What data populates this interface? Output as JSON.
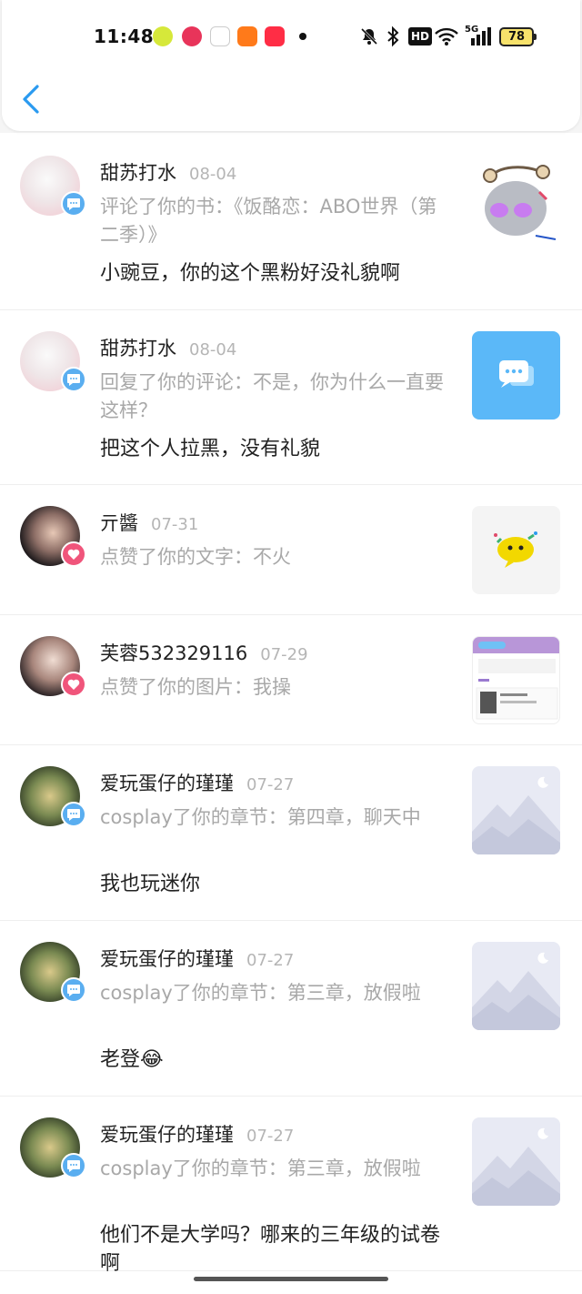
{
  "status_bar": {
    "time": "11:48",
    "battery": "78",
    "network": "5G",
    "hd": "HD",
    "icons": [
      "mute-bell-icon",
      "bluetooth-icon",
      "wifi-icon",
      "signal-icon"
    ]
  },
  "header": {
    "back_icon": "chevron-left-icon"
  },
  "notifications": [
    {
      "name": "甜苏打水",
      "date": "08-04",
      "type": "comment",
      "action": "评论了你的书：《饭酪恋：ABO世界（第二季）》",
      "reply": "小豌豆，你的这个黑粉好没礼貌啊",
      "thumb": "sticker-image"
    },
    {
      "name": "甜苏打水",
      "date": "08-04",
      "type": "comment",
      "action": "回复了你的评论：不是，你为什么一直要这样？",
      "reply": "把这个人拉黑，没有礼貌",
      "thumb": "message-icon"
    },
    {
      "name": "亓醬",
      "date": "07-31",
      "type": "like",
      "action": "点赞了你的文字：不火",
      "reply": "",
      "thumb": "emoji-image"
    },
    {
      "name": "芙蓉532329116",
      "date": "07-29",
      "type": "like",
      "action": "点赞了你的图片：我操",
      "reply": "",
      "thumb": "screenshot-image"
    },
    {
      "name": "爱玩蛋仔的瑾瑾",
      "date": "07-27",
      "type": "comment",
      "action": "cosplay了你的章节：第四章，聊天中",
      "reply": "我也玩迷你",
      "thumb": "placeholder-image"
    },
    {
      "name": "爱玩蛋仔的瑾瑾",
      "date": "07-27",
      "type": "comment",
      "action": "cosplay了你的章节：第三章，放假啦",
      "reply": "老登😂",
      "thumb": "placeholder-image"
    },
    {
      "name": "爱玩蛋仔的瑾瑾",
      "date": "07-27",
      "type": "comment",
      "action": "cosplay了你的章节：第三章，放假啦",
      "reply": "他们不是大学吗？哪来的三年级的试卷啊",
      "thumb": "placeholder-image"
    }
  ]
}
